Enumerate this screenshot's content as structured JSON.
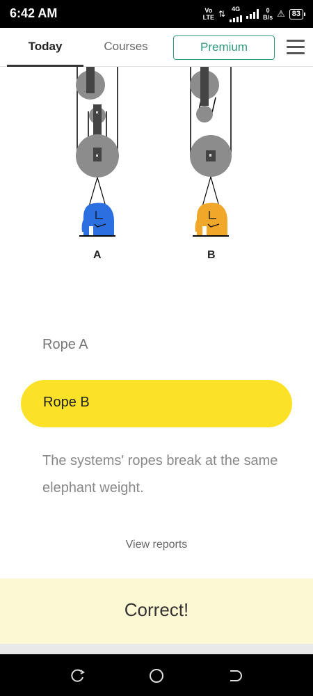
{
  "status_bar": {
    "time": "6:42 AM",
    "volte_top": "Vo",
    "volte_bottom": "LTE",
    "network": "4G",
    "speed_value": "0",
    "speed_unit": "B/s",
    "battery": "83"
  },
  "nav": {
    "tabs": [
      {
        "label": "Today",
        "active": true
      },
      {
        "label": "Courses",
        "active": false
      }
    ],
    "premium_label": "Premium",
    "menu_icon": "hamburger-menu-icon"
  },
  "illustration": {
    "systems": [
      {
        "label": "A",
        "elephant_color": "#2b6fe0"
      },
      {
        "label": "B",
        "elephant_color": "#f0a72a"
      }
    ],
    "pulley_color": "#8c8c8c",
    "bar_color": "#444444"
  },
  "question": {
    "options": [
      {
        "label": "Rope A",
        "selected": false
      },
      {
        "label": "Rope B",
        "selected": true
      },
      {
        "label": "The systems' ropes break at the same elephant weight.",
        "selected": false
      }
    ],
    "selected_color": "#fbe228",
    "view_reports_label": "View reports"
  },
  "feedback": {
    "text": "Correct!",
    "background": "#fdf8d4"
  },
  "system_nav": {
    "icons": [
      "recent-apps-icon",
      "home-icon",
      "back-icon"
    ]
  }
}
